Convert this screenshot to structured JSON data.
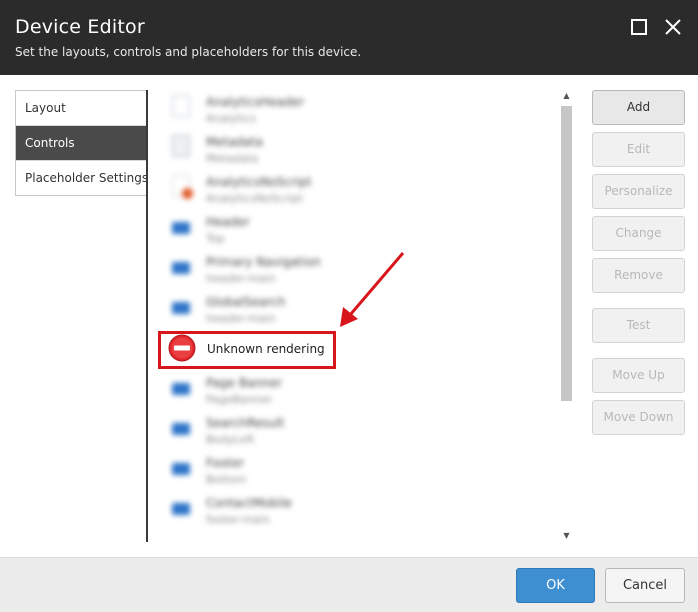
{
  "dialog": {
    "title": "Device Editor",
    "subtitle": "Set the layouts, controls and placeholders for this device."
  },
  "tabs": [
    {
      "label": "Layout",
      "active": false
    },
    {
      "label": "Controls",
      "active": true
    },
    {
      "label": "Placeholder Settings",
      "active": false
    }
  ],
  "controls": {
    "blurred_items": [
      {
        "name": "AnalyticsHeader",
        "sub": "Analytics",
        "icon": "chart-doc-icon"
      },
      {
        "name": "Metadata",
        "sub": "Metadata",
        "icon": "document-icon"
      },
      {
        "name": "AnalyticsNoScript",
        "sub": "AnalyticsNoScript",
        "icon": "script-doc-icon"
      },
      {
        "name": "Header",
        "sub": "Top",
        "icon": "rendering-icon"
      },
      {
        "name": "Primary Navigation",
        "sub": "header-main",
        "icon": "rendering-icon"
      },
      {
        "name": "GlobalSearch",
        "sub": "header-main",
        "icon": "rendering-icon"
      },
      {
        "name": "Page Banner",
        "sub": "PageBanner",
        "icon": "rendering-icon"
      },
      {
        "name": "SearchResult",
        "sub": "BodyLeft",
        "icon": "rendering-icon"
      },
      {
        "name": "Footer",
        "sub": "Bottom",
        "icon": "rendering-icon"
      },
      {
        "name": "ContactMobile",
        "sub": "footer-main",
        "icon": "rendering-icon"
      }
    ],
    "highlighted_item": {
      "name": "Unknown rendering",
      "icon": "no-entry-icon"
    }
  },
  "buttons": {
    "add": "Add",
    "edit": "Edit",
    "personalize": "Personalize",
    "change": "Change",
    "remove": "Remove",
    "test": "Test",
    "move_up": "Move Up",
    "move_down": "Move Down"
  },
  "footer": {
    "ok": "OK",
    "cancel": "Cancel"
  },
  "colors": {
    "titlebar": "#2b2b2b",
    "highlight": "#d8151b",
    "primary_button": "#3d8fd1",
    "active_tab": "#4a4a4a"
  }
}
